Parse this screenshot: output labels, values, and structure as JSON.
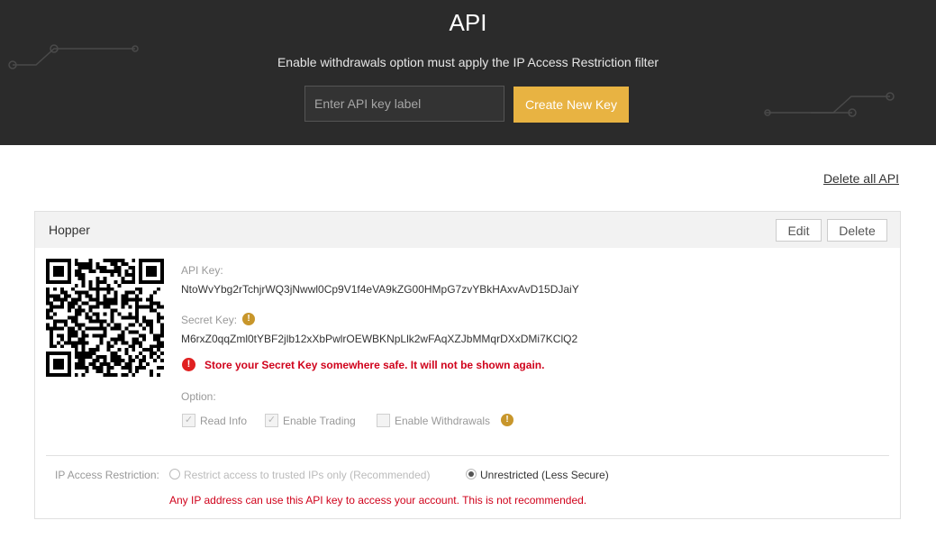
{
  "header": {
    "title": "API",
    "subtitle": "Enable withdrawals option must apply the IP Access Restriction filter",
    "key_input": {
      "placeholder": "Enter API key label",
      "value": ""
    },
    "create_button": "Create New Key"
  },
  "delete_all_link": "Delete all API",
  "api_card": {
    "name": "Hopper",
    "edit_button": "Edit",
    "delete_button": "Delete",
    "api_key_label": "API Key:",
    "api_key_value": "NtoWvYbg2rTchjrWQ3jNwwl0Cp9V1f4eVA9kZG00HMpG7zvYBkHAxvAvD15DJaiY",
    "secret_key_label": "Secret Key:",
    "secret_key_value": "M6rxZ0qqZml0tYBF2jlb12xXbPwlrOEWBKNpLlk2wFAqXZJbMMqrDXxDMi7KClQ2",
    "secret_warning": "Store your Secret Key somewhere safe. It will not be shown again.",
    "option_label": "Option:",
    "options": [
      {
        "label": "Read Info",
        "checked": true,
        "disabled": true
      },
      {
        "label": "Enable Trading",
        "checked": true,
        "disabled": true
      },
      {
        "label": "Enable Withdrawals",
        "checked": false,
        "disabled": true
      }
    ],
    "ip_restriction": {
      "label": "IP Access Restriction:",
      "options": [
        {
          "label": "Restrict access to trusted IPs only (Recommended)",
          "selected": false,
          "disabled": true
        },
        {
          "label": "Unrestricted (Less Secure)",
          "selected": true,
          "disabled": false
        }
      ],
      "warning": "Any IP address can use this API key to access your account. This is not recommended."
    }
  },
  "icons": {
    "info": "info-exclamation-icon",
    "error": "error-exclamation-icon",
    "qr": "qr-code-icon",
    "checkbox": "checkmark-icon"
  },
  "colors": {
    "header_bg": "#2b2b2b",
    "accent": "#e8b342",
    "error": "#d0021b",
    "info": "#c8962b"
  }
}
